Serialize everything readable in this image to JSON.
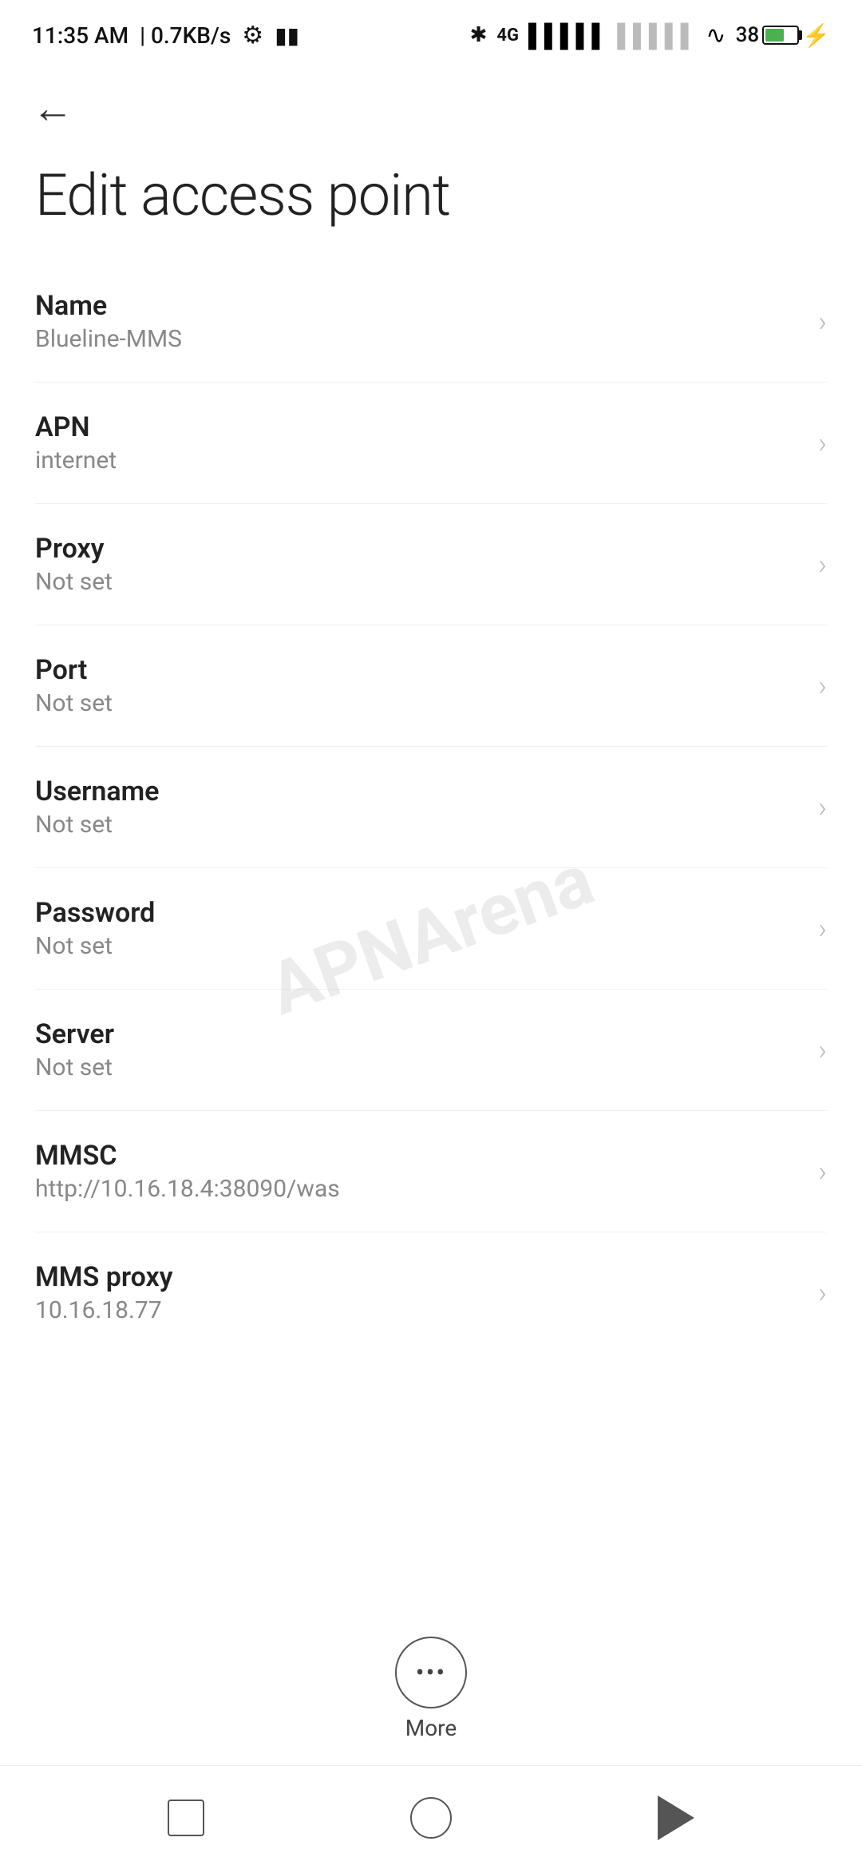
{
  "statusBar": {
    "time": "11:35 AM",
    "speed": "0.7KB/s"
  },
  "page": {
    "title": "Edit access point",
    "backLabel": "←"
  },
  "settings": [
    {
      "label": "Name",
      "value": "Blueline-MMS"
    },
    {
      "label": "APN",
      "value": "internet"
    },
    {
      "label": "Proxy",
      "value": "Not set"
    },
    {
      "label": "Port",
      "value": "Not set"
    },
    {
      "label": "Username",
      "value": "Not set"
    },
    {
      "label": "Password",
      "value": "Not set"
    },
    {
      "label": "Server",
      "value": "Not set"
    },
    {
      "label": "MMSC",
      "value": "http://10.16.18.4:38090/was"
    },
    {
      "label": "MMS proxy",
      "value": "10.16.18.77"
    }
  ],
  "more": {
    "label": "More"
  },
  "watermark": "APNArena"
}
